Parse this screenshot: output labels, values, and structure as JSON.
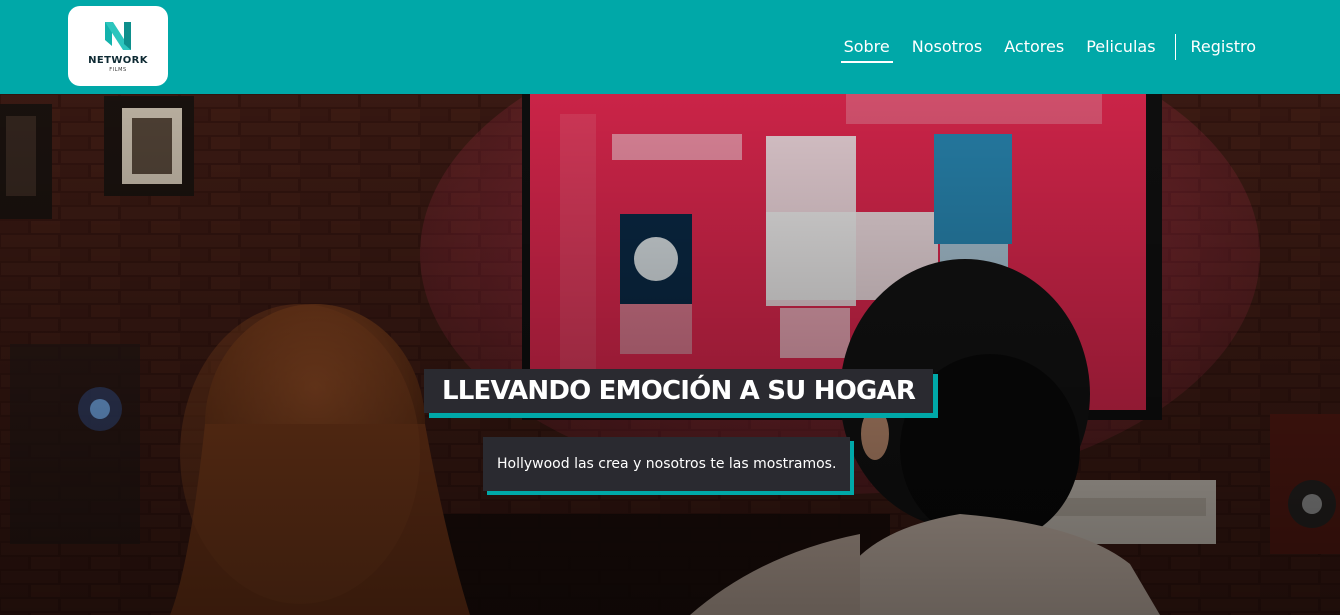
{
  "brand": {
    "name": "NETWORK",
    "sub": "FILMS",
    "logo_icon": "n-letter-logo",
    "color": "#00a8a8"
  },
  "nav": {
    "items": [
      {
        "label": "Sobre",
        "active": true
      },
      {
        "label": "Nosotros",
        "active": false
      },
      {
        "label": "Actores",
        "active": false
      },
      {
        "label": "Peliculas",
        "active": false
      }
    ],
    "register": "Registro"
  },
  "hero": {
    "headline": "LLEVANDO EMOCIÓN A SU HOGAR",
    "subline": "Hollywood las crea y nosotros te las mostramos.",
    "background_image": "couple-watching-tv-photo"
  }
}
